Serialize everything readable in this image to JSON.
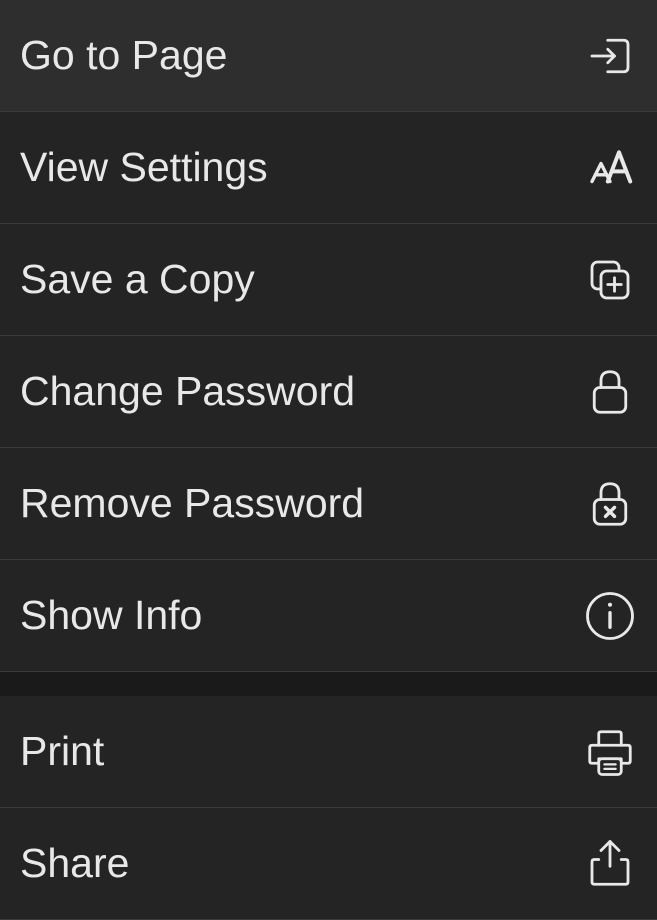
{
  "menu": {
    "items": [
      {
        "label": "Go to Page",
        "icon": "go-to-page-icon"
      },
      {
        "label": "View Settings",
        "icon": "view-settings-icon"
      },
      {
        "label": "Save a Copy",
        "icon": "save-copy-icon"
      },
      {
        "label": "Change Password",
        "icon": "lock-icon"
      },
      {
        "label": "Remove Password",
        "icon": "lock-remove-icon"
      },
      {
        "label": "Show Info",
        "icon": "info-icon"
      }
    ],
    "items2": [
      {
        "label": "Print",
        "icon": "print-icon"
      },
      {
        "label": "Share",
        "icon": "share-icon"
      }
    ]
  }
}
